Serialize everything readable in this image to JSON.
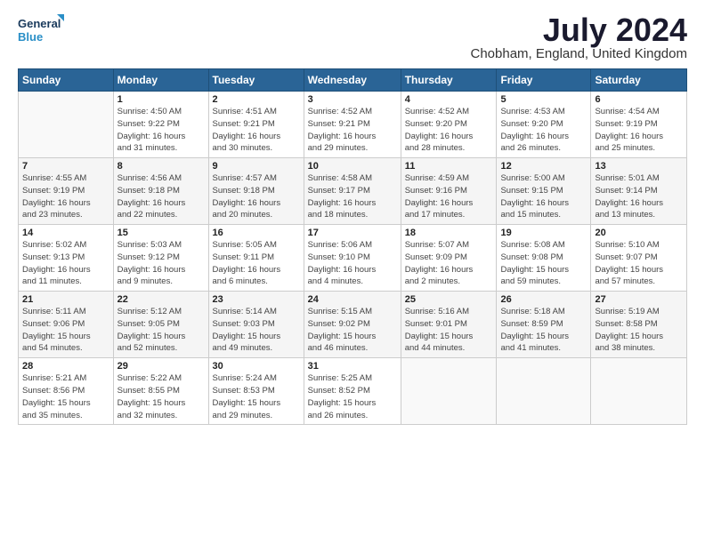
{
  "logo": {
    "line1": "General",
    "line2": "Blue"
  },
  "title": "July 2024",
  "location": "Chobham, England, United Kingdom",
  "days_of_week": [
    "Sunday",
    "Monday",
    "Tuesday",
    "Wednesday",
    "Thursday",
    "Friday",
    "Saturday"
  ],
  "weeks": [
    [
      {
        "day": "",
        "info": ""
      },
      {
        "day": "1",
        "info": "Sunrise: 4:50 AM\nSunset: 9:22 PM\nDaylight: 16 hours\nand 31 minutes."
      },
      {
        "day": "2",
        "info": "Sunrise: 4:51 AM\nSunset: 9:21 PM\nDaylight: 16 hours\nand 30 minutes."
      },
      {
        "day": "3",
        "info": "Sunrise: 4:52 AM\nSunset: 9:21 PM\nDaylight: 16 hours\nand 29 minutes."
      },
      {
        "day": "4",
        "info": "Sunrise: 4:52 AM\nSunset: 9:20 PM\nDaylight: 16 hours\nand 28 minutes."
      },
      {
        "day": "5",
        "info": "Sunrise: 4:53 AM\nSunset: 9:20 PM\nDaylight: 16 hours\nand 26 minutes."
      },
      {
        "day": "6",
        "info": "Sunrise: 4:54 AM\nSunset: 9:19 PM\nDaylight: 16 hours\nand 25 minutes."
      }
    ],
    [
      {
        "day": "7",
        "info": "Sunrise: 4:55 AM\nSunset: 9:19 PM\nDaylight: 16 hours\nand 23 minutes."
      },
      {
        "day": "8",
        "info": "Sunrise: 4:56 AM\nSunset: 9:18 PM\nDaylight: 16 hours\nand 22 minutes."
      },
      {
        "day": "9",
        "info": "Sunrise: 4:57 AM\nSunset: 9:18 PM\nDaylight: 16 hours\nand 20 minutes."
      },
      {
        "day": "10",
        "info": "Sunrise: 4:58 AM\nSunset: 9:17 PM\nDaylight: 16 hours\nand 18 minutes."
      },
      {
        "day": "11",
        "info": "Sunrise: 4:59 AM\nSunset: 9:16 PM\nDaylight: 16 hours\nand 17 minutes."
      },
      {
        "day": "12",
        "info": "Sunrise: 5:00 AM\nSunset: 9:15 PM\nDaylight: 16 hours\nand 15 minutes."
      },
      {
        "day": "13",
        "info": "Sunrise: 5:01 AM\nSunset: 9:14 PM\nDaylight: 16 hours\nand 13 minutes."
      }
    ],
    [
      {
        "day": "14",
        "info": "Sunrise: 5:02 AM\nSunset: 9:13 PM\nDaylight: 16 hours\nand 11 minutes."
      },
      {
        "day": "15",
        "info": "Sunrise: 5:03 AM\nSunset: 9:12 PM\nDaylight: 16 hours\nand 9 minutes."
      },
      {
        "day": "16",
        "info": "Sunrise: 5:05 AM\nSunset: 9:11 PM\nDaylight: 16 hours\nand 6 minutes."
      },
      {
        "day": "17",
        "info": "Sunrise: 5:06 AM\nSunset: 9:10 PM\nDaylight: 16 hours\nand 4 minutes."
      },
      {
        "day": "18",
        "info": "Sunrise: 5:07 AM\nSunset: 9:09 PM\nDaylight: 16 hours\nand 2 minutes."
      },
      {
        "day": "19",
        "info": "Sunrise: 5:08 AM\nSunset: 9:08 PM\nDaylight: 15 hours\nand 59 minutes."
      },
      {
        "day": "20",
        "info": "Sunrise: 5:10 AM\nSunset: 9:07 PM\nDaylight: 15 hours\nand 57 minutes."
      }
    ],
    [
      {
        "day": "21",
        "info": "Sunrise: 5:11 AM\nSunset: 9:06 PM\nDaylight: 15 hours\nand 54 minutes."
      },
      {
        "day": "22",
        "info": "Sunrise: 5:12 AM\nSunset: 9:05 PM\nDaylight: 15 hours\nand 52 minutes."
      },
      {
        "day": "23",
        "info": "Sunrise: 5:14 AM\nSunset: 9:03 PM\nDaylight: 15 hours\nand 49 minutes."
      },
      {
        "day": "24",
        "info": "Sunrise: 5:15 AM\nSunset: 9:02 PM\nDaylight: 15 hours\nand 46 minutes."
      },
      {
        "day": "25",
        "info": "Sunrise: 5:16 AM\nSunset: 9:01 PM\nDaylight: 15 hours\nand 44 minutes."
      },
      {
        "day": "26",
        "info": "Sunrise: 5:18 AM\nSunset: 8:59 PM\nDaylight: 15 hours\nand 41 minutes."
      },
      {
        "day": "27",
        "info": "Sunrise: 5:19 AM\nSunset: 8:58 PM\nDaylight: 15 hours\nand 38 minutes."
      }
    ],
    [
      {
        "day": "28",
        "info": "Sunrise: 5:21 AM\nSunset: 8:56 PM\nDaylight: 15 hours\nand 35 minutes."
      },
      {
        "day": "29",
        "info": "Sunrise: 5:22 AM\nSunset: 8:55 PM\nDaylight: 15 hours\nand 32 minutes."
      },
      {
        "day": "30",
        "info": "Sunrise: 5:24 AM\nSunset: 8:53 PM\nDaylight: 15 hours\nand 29 minutes."
      },
      {
        "day": "31",
        "info": "Sunrise: 5:25 AM\nSunset: 8:52 PM\nDaylight: 15 hours\nand 26 minutes."
      },
      {
        "day": "",
        "info": ""
      },
      {
        "day": "",
        "info": ""
      },
      {
        "day": "",
        "info": ""
      }
    ]
  ]
}
